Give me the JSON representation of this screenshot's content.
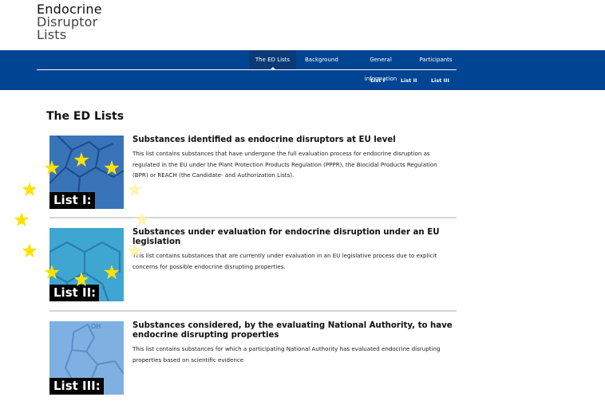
{
  "logo": {
    "line1": "Endocrine",
    "line2": "Disruptor",
    "line3": "Lists"
  },
  "nav": {
    "items": [
      {
        "label": "The ED Lists",
        "active": true
      },
      {
        "label": "Background"
      },
      {
        "label": "General information"
      },
      {
        "label": "Participants"
      }
    ],
    "sub_items": [
      {
        "label": "List I"
      },
      {
        "label": "List II"
      },
      {
        "label": "List III"
      }
    ]
  },
  "colors": {
    "nav_bg": "#004494",
    "star": "#ffe100"
  },
  "page": {
    "title": "The ED Lists"
  },
  "lists": [
    {
      "badge": "List I:",
      "title": "Substances identified as endocrine disruptors at EU level",
      "description": "This list contains substances that have undergone the full evaluation process for endocrine disruption as regulated in the EU under the Plant Protection Products Regulation (PPPR), the Biocidal Products Regulation (BPR) or REACH (the Candidate- and Authorization Lists)."
    },
    {
      "badge": "List II:",
      "title": "Substances under evaluation for endocrine disruption under an EU legislation",
      "description": "This list contains substances that are currently under evaluation in an EU legislative process due to explicit concerns for possible endocrine disrupting properties."
    },
    {
      "badge": "List III:",
      "title": "Substances considered, by the evaluating National Authority, to have endocrine disrupting properties",
      "description": "This list contains substances for which a participating National Authority has evaluated endocrine disrupting properties based on scientific evidence"
    }
  ]
}
